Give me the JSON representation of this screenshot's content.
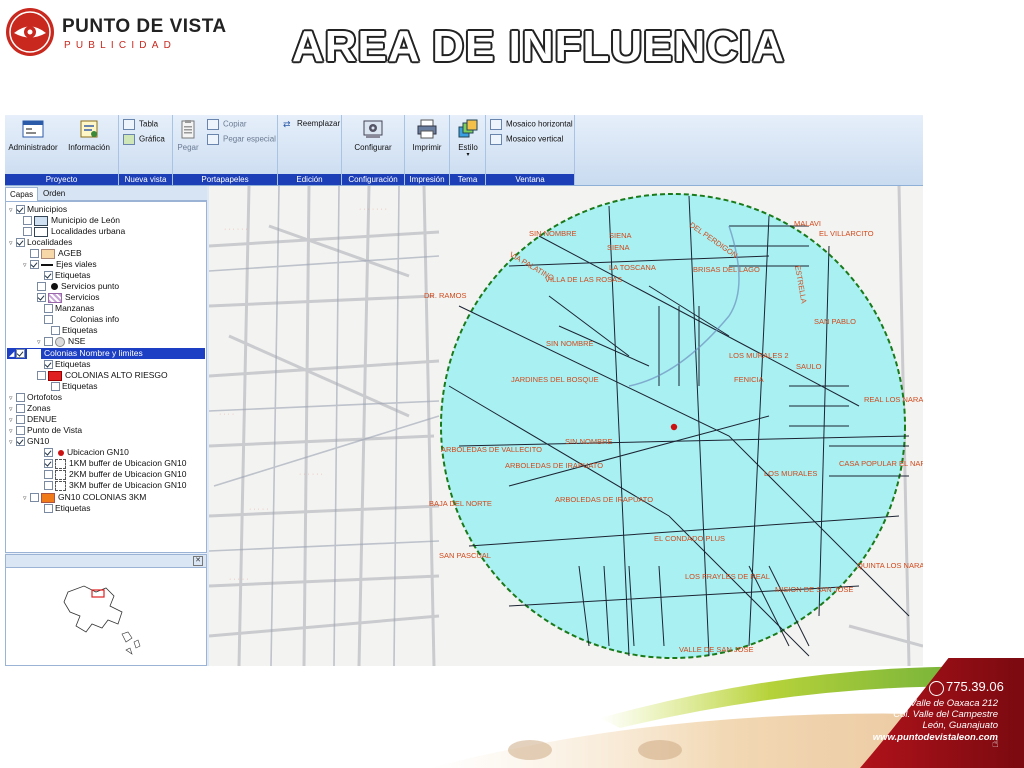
{
  "header": {
    "brand_name": "PUNTO DE VISTA",
    "brand_sub": "PUBLICIDAD",
    "title": "AREA DE INFLUENCIA"
  },
  "ribbon": {
    "groups": [
      {
        "caption": "Proyecto",
        "buttons": [
          "Administrador",
          "Información"
        ]
      },
      {
        "caption": "Nueva vista",
        "buttons": [
          "Tabla",
          "Gráfica"
        ]
      },
      {
        "caption": "Portapapeles",
        "buttons": [
          "Pegar",
          "Copiar",
          "Pegar especial"
        ]
      },
      {
        "caption": "Edición",
        "buttons": [
          "Reemplazar"
        ]
      },
      {
        "caption": "Configuración",
        "buttons": [
          "Configurar"
        ]
      },
      {
        "caption": "Impresión",
        "buttons": [
          "Imprimir"
        ]
      },
      {
        "caption": "Tema",
        "buttons": [
          "Estilo"
        ]
      },
      {
        "caption": "Ventana",
        "buttons": [
          "Mosaico horizontal",
          "Mosaico vertical"
        ]
      }
    ]
  },
  "panel": {
    "tabs": [
      "Capas",
      "Orden"
    ],
    "layers": [
      {
        "label": "Municipios",
        "checked": true
      },
      {
        "label": "Municipio de León",
        "checked": false
      },
      {
        "label": "Localidades urbana",
        "checked": false
      },
      {
        "label": "Localidades",
        "checked": true
      },
      {
        "label": "AGEB",
        "checked": false
      },
      {
        "label": "Ejes viales",
        "checked": true
      },
      {
        "label": "Etiquetas",
        "checked": true
      },
      {
        "label": "Servicios punto",
        "checked": false
      },
      {
        "label": "Servicios",
        "checked": true
      },
      {
        "label": "Manzanas",
        "checked": false
      },
      {
        "label": "Colonias info",
        "checked": false
      },
      {
        "label": "Etiquetas",
        "checked": false
      },
      {
        "label": "NSE",
        "checked": false
      },
      {
        "label": "Colonias Nombre y limites",
        "checked": true
      },
      {
        "label": "Etiquetas",
        "checked": true
      },
      {
        "label": "COLONIAS ALTO RIESGO",
        "checked": false
      },
      {
        "label": "Etiquetas",
        "checked": false
      },
      {
        "label": "Ortofotos",
        "checked": false
      },
      {
        "label": "Zonas",
        "checked": false
      },
      {
        "label": "DENUE",
        "checked": false
      },
      {
        "label": "Punto de Vista",
        "checked": false
      },
      {
        "label": "GN10",
        "checked": true
      },
      {
        "label": "Ubicacion GN10",
        "checked": true
      },
      {
        "label": "1KM buffer de Ubicacion GN10",
        "checked": true
      },
      {
        "label": "2KM buffer de Ubicacion GN10",
        "checked": false
      },
      {
        "label": "3KM buffer de Ubicacion GN10",
        "checked": false
      },
      {
        "label": "GN10 COLONIAS 3KM",
        "checked": false
      },
      {
        "label": "Etiquetas",
        "checked": false
      }
    ]
  },
  "map": {
    "labels": [
      "SIN NOMBRE",
      "SIENA",
      "SIENA",
      "DEL PERDIGON",
      "MALAVI",
      "EL VILLARCITO",
      "VIA PALATINO",
      "LA TOSCANA",
      "VILLA DE LAS ROSAS",
      "BRISAS DEL LAGO",
      "ESTRELLA",
      "SAN PABLO",
      "SIN NOMBRE",
      "LOS MURALES 2",
      "SAULO",
      "JARDINES DEL BOSQUE",
      "FENICIA",
      "REAL LOS NARANJOS",
      "SIN NOMBRE",
      "ARBOLEDAS DE IRAPUATO",
      "ARBOLEDAS DE VALLECITO",
      "LOS MURALES",
      "CASA POPULAR EL NARANJO",
      "ARBOLEDAS DE IRAPUATO",
      "BAJA DEL NORTE",
      "EL CONDADO PLUS",
      "QUINTA LOS NARANJOS",
      "LOS FRAYLES DE REAL",
      "MISION DE SAN JOSE",
      "VALLE DE SAN JOSE",
      "SAN PASCUAL",
      "DR. RAMOS"
    ],
    "colors": {
      "buffer_fill": "#a8f0f2",
      "buffer_stroke": "#1a7a1a",
      "label": "#d24a1c",
      "point": "#cc1111"
    }
  },
  "contact": {
    "phone": "775.39.06",
    "address_line1": "Valle de Oaxaca 212",
    "address_line2": "Col. Valle del Campestre",
    "address_line3": "León, Guanajuato",
    "website": "www.puntodevistaleon.com"
  }
}
